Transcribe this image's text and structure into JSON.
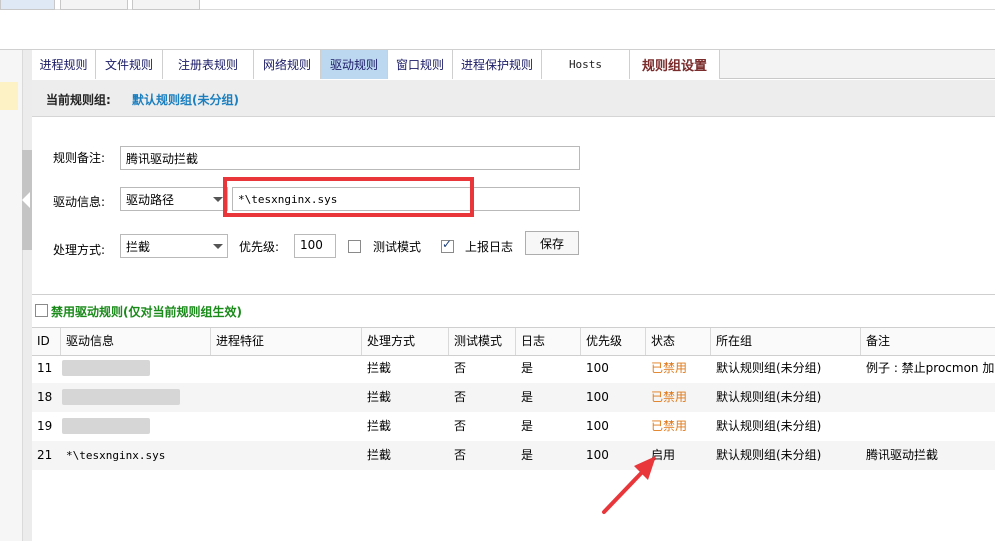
{
  "tabs": [
    {
      "label": "进程规则"
    },
    {
      "label": "文件规则"
    },
    {
      "label": "注册表规则"
    },
    {
      "label": "网络规则"
    },
    {
      "label": "驱动规则"
    },
    {
      "label": "窗口规则"
    },
    {
      "label": "进程保护规则"
    },
    {
      "label": "Hosts"
    },
    {
      "label": "规则组设置"
    }
  ],
  "active_tab": "驱动规则",
  "group": {
    "label": "当前规则组:",
    "value": "默认规则组(未分组)"
  },
  "form": {
    "note_label": "规则备注:",
    "note_value": "腾讯驱动拦截",
    "driver_label": "驱动信息:",
    "driver_type": "驱动路径",
    "driver_value": "*\\tesxnginx.sys",
    "action_label": "处理方式:",
    "action_value": "拦截",
    "priority_label": "优先级:",
    "priority_value": "100",
    "test_mode_label": "测试模式",
    "test_mode_checked": false,
    "log_label": "上报日志",
    "log_checked": true,
    "save_label": "保存"
  },
  "disable_rules_label": "禁用驱动规则(仅对当前规则组生效)",
  "table": {
    "columns": [
      "ID",
      "驱动信息",
      "进程特征",
      "处理方式",
      "测试模式",
      "日志",
      "优先级",
      "状态",
      "所在组",
      "备注"
    ],
    "rows": [
      {
        "id": "11",
        "driver": "",
        "proc": "",
        "action": "拦截",
        "test": "否",
        "log": "是",
        "priority": "100",
        "status": "已禁用",
        "group": "默认规则组(未分组)",
        "note": "例子 : 禁止procmon 加"
      },
      {
        "id": "18",
        "driver": "",
        "proc": "",
        "action": "拦截",
        "test": "否",
        "log": "是",
        "priority": "100",
        "status": "已禁用",
        "group": "默认规则组(未分组)",
        "note": ""
      },
      {
        "id": "19",
        "driver": "",
        "proc": "",
        "action": "拦截",
        "test": "否",
        "log": "是",
        "priority": "100",
        "status": "已禁用",
        "group": "默认规则组(未分组)",
        "note": ""
      },
      {
        "id": "21",
        "driver": "*\\tesxnginx.sys",
        "proc": "",
        "action": "拦截",
        "test": "否",
        "log": "是",
        "priority": "100",
        "status": "启用",
        "group": "默认规则组(未分组)",
        "note": "腾讯驱动拦截"
      }
    ]
  },
  "colors": {
    "active_tab": "#bcd7f0",
    "group_value": "#1b7fbf",
    "disabled_status": "#e07a1a",
    "disable_rules_text": "#1a8a1a",
    "annotation_red": "#e8363a"
  }
}
